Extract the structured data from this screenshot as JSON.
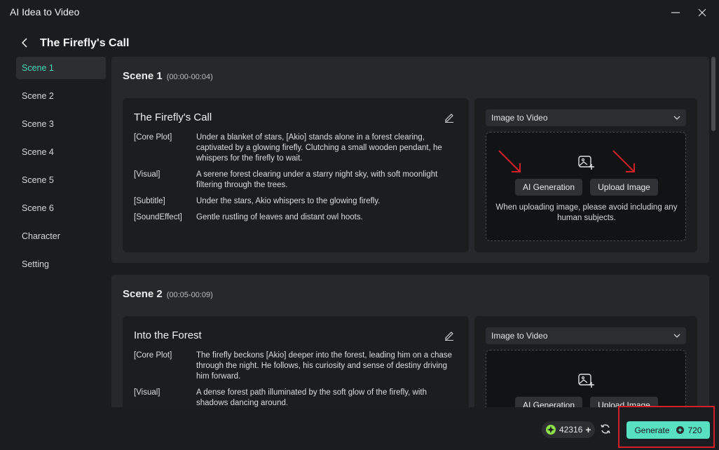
{
  "app_title": "AI Idea to Video",
  "page_title": "The Firefly's Call",
  "sidebar": {
    "items": [
      {
        "label": "Scene 1"
      },
      {
        "label": "Scene 2"
      },
      {
        "label": "Scene 3"
      },
      {
        "label": "Scene 4"
      },
      {
        "label": "Scene 5"
      },
      {
        "label": "Scene 6"
      },
      {
        "label": "Character"
      },
      {
        "label": "Setting"
      }
    ]
  },
  "scenes": [
    {
      "heading": "Scene 1",
      "time": "(00:00-00:04)",
      "title": "The Firefly's Call",
      "rows": [
        {
          "key": "[Core Plot]",
          "value": "Under a blanket of stars, [Akio] stands alone in a forest clearing, captivated by a glowing firefly. Clutching a small wooden pendant, he whispers for the firefly to wait."
        },
        {
          "key": "[Visual]",
          "value": "A serene forest clearing under a starry night sky, with soft moonlight filtering through the trees."
        },
        {
          "key": "[Subtitle]",
          "value": "Under the stars, Akio whispers to the glowing firefly."
        },
        {
          "key": "[SoundEffect]",
          "value": "Gentle rustling of leaves and distant owl hoots."
        }
      ],
      "mode": "Image to Video",
      "ai_generation_label": "AI Generation",
      "upload_image_label": "Upload Image",
      "hint": "When uploading image, please avoid including any human subjects."
    },
    {
      "heading": "Scene 2",
      "time": "(00:05-00:09)",
      "title": "Into the Forest",
      "rows": [
        {
          "key": "[Core Plot]",
          "value": "The firefly beckons [Akio] deeper into the forest, leading him on a chase through the night. He follows, his curiosity and sense of destiny driving him forward."
        },
        {
          "key": "[Visual]",
          "value": "A dense forest path illuminated by the soft glow of the firefly, with shadows dancing around."
        }
      ],
      "mode": "Image to Video",
      "ai_generation_label": "AI Generation",
      "upload_image_label": "Upload Image"
    }
  ],
  "footer": {
    "credits": "42316",
    "generate_label": "Generate",
    "generate_cost": "720"
  },
  "colors": {
    "accent": "#44d7b6",
    "generate_bg": "#57e0c2",
    "annotation_red": "#d0202a"
  },
  "icons": [
    "back-arrow-icon",
    "minimize-icon",
    "close-icon",
    "edit-icon",
    "chevron-down-icon",
    "image-add-icon",
    "coin-icon",
    "plus-icon",
    "refresh-icon",
    "credit-icon"
  ]
}
